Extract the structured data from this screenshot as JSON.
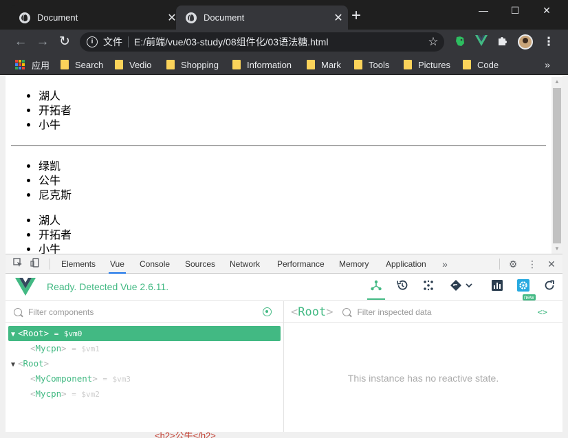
{
  "window": {
    "tabs": [
      {
        "title": "Document",
        "close": "✕",
        "active": false
      },
      {
        "title": "Document",
        "close": "✕",
        "active": true
      }
    ],
    "new_tab": "+",
    "minimize": "—",
    "maximize": "☐",
    "close": "✕"
  },
  "toolbar": {
    "back": "←",
    "forward": "→",
    "reload": "↻",
    "info": "i",
    "label": "文件",
    "url": "E:/前端/vue/03-study/08组件化/03语法糖.html",
    "star": "☆",
    "menu": "⋮"
  },
  "bookmarks": {
    "apps": "应用",
    "items": [
      "Search",
      "Vedio",
      "Shopping",
      "Information",
      "Mark",
      "Tools",
      "Pictures",
      "Code"
    ],
    "more": "»",
    "apps_colors": [
      "#ea4335",
      "#fbbc05",
      "#34a853",
      "#4285f4",
      "#ea4335",
      "#fbbc05",
      "#34a853",
      "#4285f4",
      "#ea4335"
    ]
  },
  "page": {
    "list1": [
      "湖人",
      "开拓者",
      "小牛"
    ],
    "list2": [
      "绿凯",
      "公牛",
      "尼克斯"
    ],
    "list3": [
      "湖人",
      "开拓者",
      "小牛"
    ],
    "scroll_up": "▲",
    "scroll_down": "▼",
    "bottom_text": "<h2>公牛</h2>"
  },
  "devtools": {
    "tabs": [
      "Elements",
      "Vue",
      "Console",
      "Sources",
      "Network",
      "Performance",
      "Memory",
      "Application"
    ],
    "active_tab": "Vue",
    "more": "»",
    "settings": "⚙",
    "kebab": "⋮",
    "close": "✕"
  },
  "vue": {
    "status": "Ready. Detected Vue 2.6.11.",
    "new_badge": "new",
    "filter_components": "Filter components",
    "filter_inspected": "Filter inspected data",
    "inspected_root": "Root",
    "code_toggle": "<>",
    "empty_state": "This instance has no reactive state.",
    "accent": "#42b983",
    "tree": [
      {
        "name": "Root",
        "vm": "$vm0",
        "caret": "▼",
        "selected": true,
        "indent": 0
      },
      {
        "name": "Mycpn",
        "vm": "$vm1",
        "caret": "",
        "selected": false,
        "indent": 1
      },
      {
        "name": "Root",
        "vm": "",
        "caret": "▼",
        "selected": false,
        "indent": 0
      },
      {
        "name": "MyComponent",
        "vm": "$vm3",
        "caret": "",
        "selected": false,
        "indent": 1
      },
      {
        "name": "Mycpn",
        "vm": "$vm2",
        "caret": "",
        "selected": false,
        "indent": 1
      }
    ]
  }
}
